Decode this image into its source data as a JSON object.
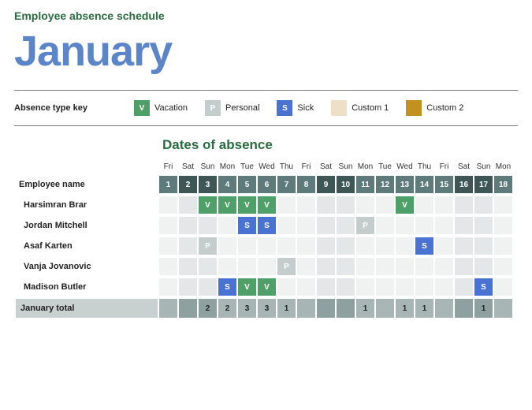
{
  "header": {
    "subtitle": "Employee absence schedule",
    "month": "January"
  },
  "legend": {
    "label": "Absence type key",
    "items": [
      {
        "code": "V",
        "label": "Vacation",
        "cls": "v"
      },
      {
        "code": "P",
        "label": "Personal",
        "cls": "p"
      },
      {
        "code": "S",
        "label": "Sick",
        "cls": "s"
      },
      {
        "code": "",
        "label": "Custom 1",
        "cls": "c1"
      },
      {
        "code": "",
        "label": "Custom 2",
        "cls": "c2"
      }
    ]
  },
  "section_title": "Dates of absence",
  "columns": {
    "dow": [
      "Fri",
      "Sat",
      "Sun",
      "Mon",
      "Tue",
      "Wed",
      "Thu",
      "Fri",
      "Sat",
      "Sun",
      "Mon",
      "Tue",
      "Wed",
      "Thu",
      "Fri",
      "Sat",
      "Sun",
      "Mon"
    ],
    "dates": [
      1,
      2,
      3,
      4,
      5,
      6,
      7,
      8,
      9,
      10,
      11,
      12,
      13,
      14,
      15,
      16,
      17,
      18
    ],
    "weekend": [
      false,
      true,
      true,
      false,
      false,
      false,
      false,
      false,
      true,
      true,
      false,
      false,
      false,
      false,
      false,
      true,
      true,
      false
    ]
  },
  "row_header": "Employee name",
  "employees": [
    {
      "name": "Harsimran Brar",
      "cells": [
        "",
        "",
        "V",
        "V",
        "V",
        "V",
        "",
        "",
        "",
        "",
        "",
        "",
        "V",
        "",
        "",
        "",
        "",
        ""
      ]
    },
    {
      "name": "Jordan Mitchell",
      "cells": [
        "",
        "",
        "",
        "",
        "S",
        "S",
        "",
        "",
        "",
        "",
        "P",
        "",
        "",
        "",
        "",
        "",
        "",
        ""
      ]
    },
    {
      "name": "Asaf Karten",
      "cells": [
        "",
        "",
        "P",
        "",
        "",
        "",
        "",
        "",
        "",
        "",
        "",
        "",
        "",
        "S",
        "",
        "",
        "",
        ""
      ]
    },
    {
      "name": "Vanja Jovanovic",
      "cells": [
        "",
        "",
        "",
        "",
        "",
        "",
        "P",
        "",
        "",
        "",
        "",
        "",
        "",
        "",
        "",
        "",
        "",
        ""
      ]
    },
    {
      "name": "Madison Butler",
      "cells": [
        "",
        "",
        "",
        "S",
        "V",
        "V",
        "",
        "",
        "",
        "",
        "",
        "",
        "",
        "",
        "",
        "",
        "S",
        ""
      ]
    }
  ],
  "total": {
    "label": "January total",
    "values": [
      "",
      "",
      "2",
      "2",
      "3",
      "3",
      "1",
      "",
      "",
      "",
      "1",
      "",
      "1",
      "1",
      "",
      "",
      "1",
      ""
    ]
  }
}
